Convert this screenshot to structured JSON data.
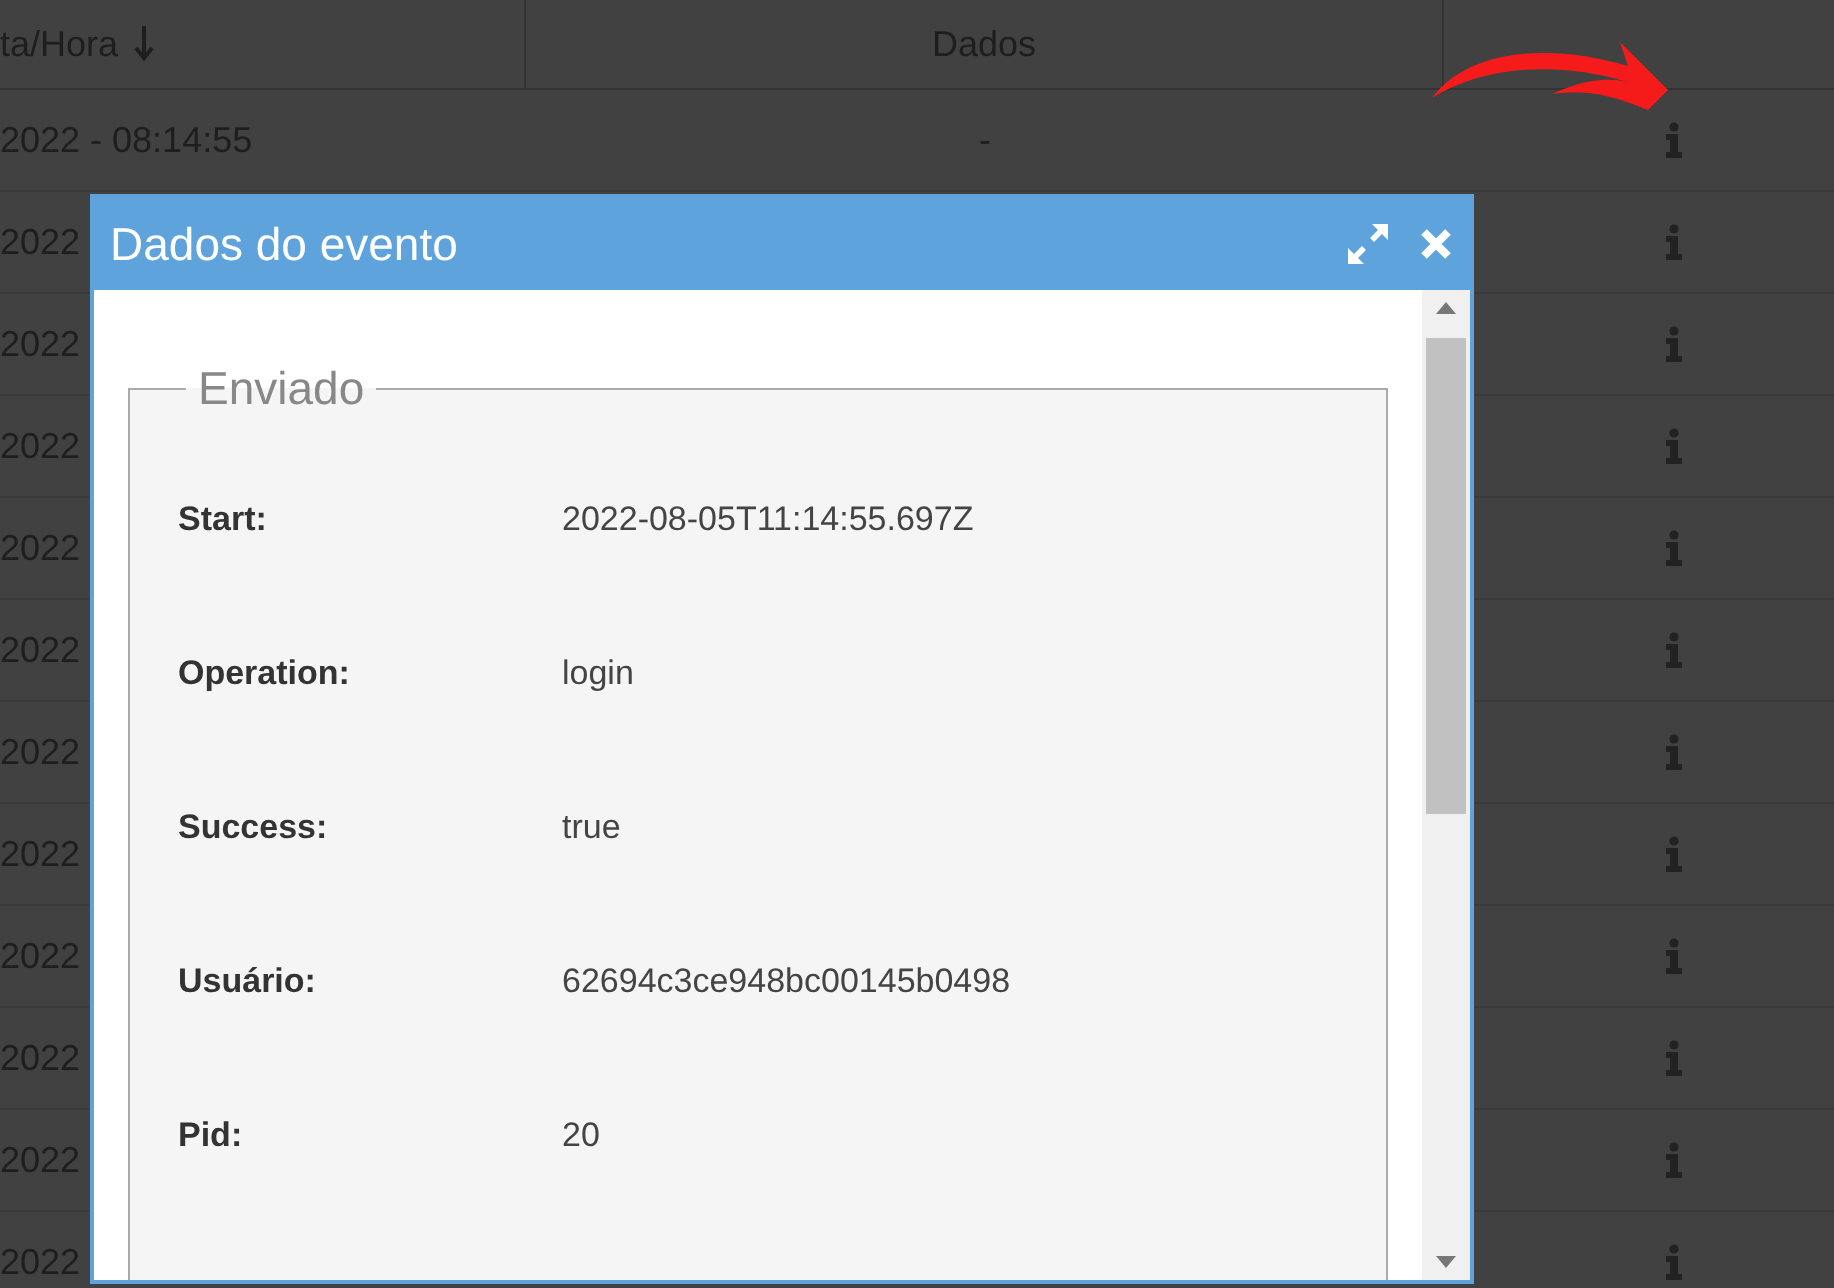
{
  "table": {
    "columns": [
      "ta/Hora",
      "Dados"
    ],
    "rows": [
      {
        "date": "2022 - 08:14:55",
        "data": "-"
      },
      {
        "date": "2022"
      },
      {
        "date": "2022"
      },
      {
        "date": "2022"
      },
      {
        "date": "2022"
      },
      {
        "date": "2022"
      },
      {
        "date": "2022"
      },
      {
        "date": "2022"
      },
      {
        "date": "2022"
      },
      {
        "date": "2022"
      },
      {
        "date": "2022"
      },
      {
        "date": "2022"
      }
    ]
  },
  "dialog": {
    "title": "Dados do evento",
    "section": "Enviado",
    "fields": [
      {
        "label": "Start:",
        "value": "2022-08-05T11:14:55.697Z"
      },
      {
        "label": "Operation:",
        "value": "login"
      },
      {
        "label": "Success:",
        "value": "true"
      },
      {
        "label": "Usuário:",
        "value": "62694c3ce948bc00145b0498"
      },
      {
        "label": "Pid:",
        "value": "20"
      }
    ]
  }
}
